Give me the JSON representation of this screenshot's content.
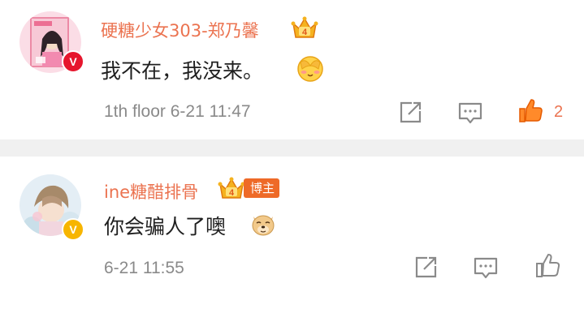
{
  "comments": [
    {
      "username": "硬糖少女303-郑乃馨",
      "text": "我不在，我没来。",
      "meta": "1th floor 6-21 11:47",
      "like_count": "2",
      "liked": true,
      "crown_level": "4",
      "badge_letter": "V",
      "badge_color": "#e6162d"
    },
    {
      "username": "ine糖醋排骨",
      "text": "你会骗人了噢",
      "meta": "6-21 11:55",
      "liked": false,
      "crown_level": "4",
      "tag": "博主",
      "badge_letter": "V",
      "badge_color": "#f7b500"
    }
  ],
  "colors": {
    "username": "#eb7350",
    "separator": "#f0f0f0",
    "icon_gray": "#8a8a8a"
  }
}
